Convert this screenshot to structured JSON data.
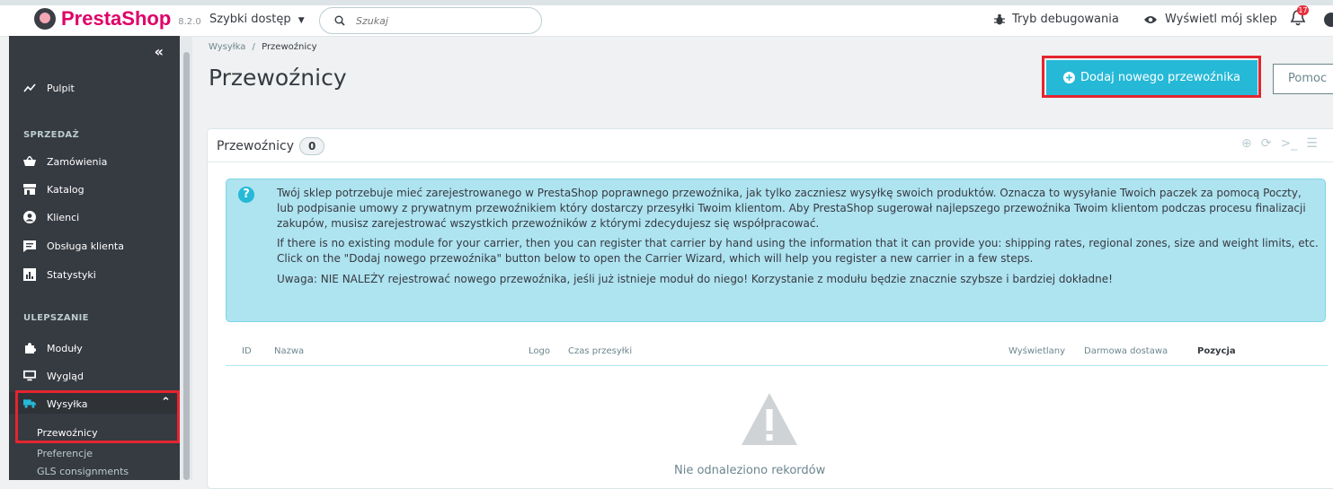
{
  "header": {
    "logo_text": "PrestaShop",
    "version": "8.2.0",
    "quick_access": "Szybki dostęp",
    "search_placeholder": "Szukaj",
    "debug_mode": "Tryb debugowania",
    "view_store": "Wyświetl mój sklep",
    "notifications_count": "17"
  },
  "sidebar": {
    "collapse": "«",
    "dashboard": "Pulpit",
    "section_sales": "SPRZEDAŻ",
    "orders": "Zamówienia",
    "catalog": "Katalog",
    "customers": "Klienci",
    "customer_service": "Obsługa klienta",
    "stats": "Statystyki",
    "section_improve": "ULEPSZANIE",
    "modules": "Moduły",
    "design": "Wygląd",
    "shipping": "Wysyłka",
    "shipping_sub": [
      "Przewoźnicy",
      "Preferencje",
      "GLS consignments"
    ]
  },
  "breadcrumb": {
    "parent": "Wysyłka",
    "separator": "/",
    "current": "Przewoźnicy"
  },
  "page_title": "Przewoźnicy",
  "toolbar": {
    "add_label": "Dodaj nowego przewoźnika",
    "help_label": "Pomoc"
  },
  "panel": {
    "title": "Przewoźnicy",
    "count": "0",
    "alert": {
      "p1": "Twój sklep potrzebuje mieć zarejestrowanego w PrestaShop poprawnego przewoźnika, jak tylko zaczniesz wysyłkę swoich produktów. Oznacza to wysyłanie Twoich paczek za pomocą Poczty, lub podpisanie umowy z prywatnym przewoźnikiem który dostarczy przesyłki Twoim klientom. Aby PrestaShop sugerował najlepszego przewoźnika Twoim klientom podczas procesu finalizacji zakupów, musisz zarejestrować wszystkich przewoźników z którymi zdecydujesz się współpracować.",
      "p2": "If there is no existing module for your carrier, then you can register that carrier by hand using the information that it can provide you: shipping rates, regional zones, size and weight limits, etc. Click on the \"Dodaj nowego przewoźnika\" button below to open the Carrier Wizard, which will help you register a new carrier in a few steps.",
      "p3": "Uwaga: NIE NALEŻY rejestrować nowego przewoźnika, jeśli już istnieje moduł do niego! Korzystanie z modułu będzie znacznie szybsze i bardziej dokładne!"
    },
    "columns": [
      "ID",
      "Nazwa",
      "Logo",
      "Czas przesyłki",
      "Wyświetlany",
      "Darmowa dostawa",
      "Pozycja"
    ],
    "empty_text": "Nie odnaleziono rekordów"
  },
  "colors": {
    "accent": "#25b9d7",
    "brand": "#df0067",
    "sidebar": "#363a41",
    "highlight": "#e4252f"
  }
}
